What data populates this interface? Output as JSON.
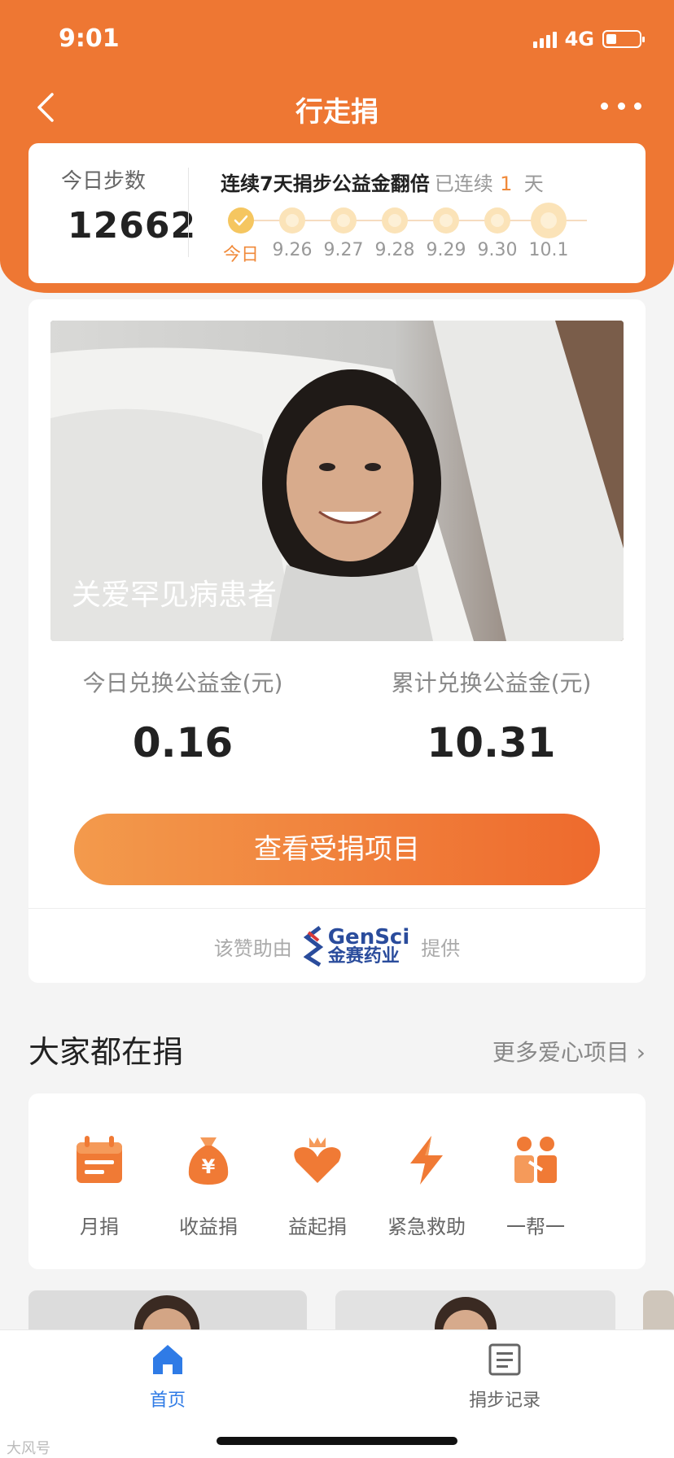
{
  "status_bar": {
    "time": "9:01",
    "network": "4G"
  },
  "nav": {
    "title": "行走捐"
  },
  "steps": {
    "label": "今日步数",
    "count": "12662",
    "streak_title": "连续7天捐步公益金翻倍",
    "streak_prefix": "已连续",
    "streak_days": "1",
    "streak_suffix": "天",
    "days": [
      "今日",
      "9.26",
      "9.27",
      "9.28",
      "9.29",
      "9.30",
      "10.1"
    ]
  },
  "project": {
    "caption": "关爱罕见病患者",
    "today_label": "今日兑换公益金(元)",
    "today_value": "0.16",
    "total_label": "累计兑换公益金(元)",
    "total_value": "10.31",
    "button_label": "查看受捐项目",
    "sponsor_prefix": "该赞助由",
    "sponsor_brand_en": "GenSci",
    "sponsor_brand_cn": "金赛药业",
    "sponsor_suffix": "提供"
  },
  "section": {
    "title": "大家都在捐",
    "more_label": "更多爱心项目"
  },
  "categories": [
    {
      "label": "月捐",
      "icon": "calendar-icon"
    },
    {
      "label": "收益捐",
      "icon": "money-bag-icon"
    },
    {
      "label": "益起捐",
      "icon": "heart-crown-icon"
    },
    {
      "label": "紧急救助",
      "icon": "lightning-icon"
    },
    {
      "label": "一帮一",
      "icon": "people-icon"
    }
  ],
  "tabs": [
    {
      "label": "首页",
      "icon": "home-icon"
    },
    {
      "label": "捐步记录",
      "icon": "record-icon"
    }
  ],
  "watermark": "大风号",
  "colors": {
    "brand": "#ee7733",
    "accent": "#f08a3a",
    "sponsor_blue": "#2a4c9c"
  }
}
